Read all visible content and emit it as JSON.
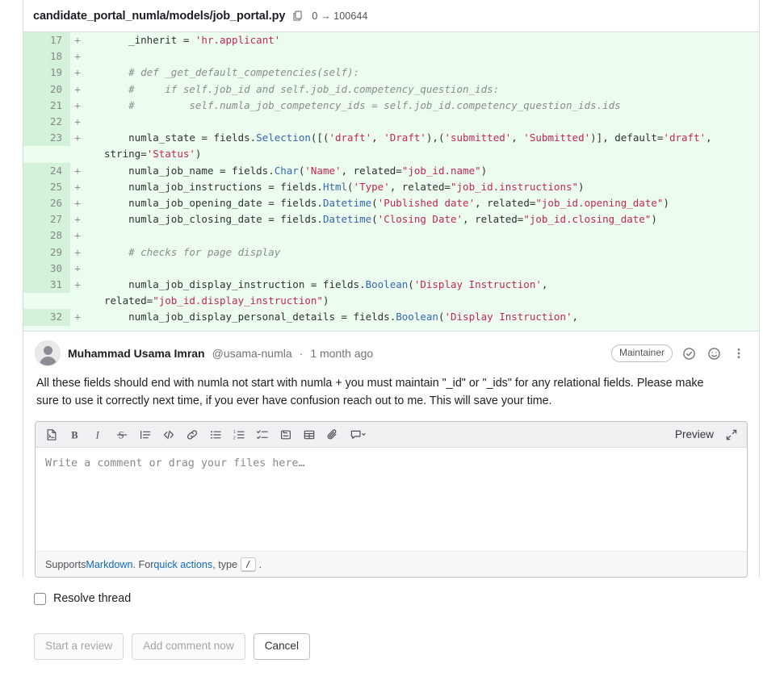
{
  "diff": {
    "file_path": "candidate_portal_numla/models/job_portal.py",
    "copy_icon": "copy-to-clipboard-icon",
    "mode_change": "0 → 100644",
    "lines": [
      {
        "number": "17",
        "marker": "+",
        "text": "    _inherit = 'hr.applicant'"
      },
      {
        "number": "18",
        "marker": "+",
        "text": ""
      },
      {
        "number": "19",
        "marker": "+",
        "text": "    # def _get_default_competencies(self):"
      },
      {
        "number": "20",
        "marker": "+",
        "text": "    #     if self.job_id and self.job_id.competency_question_ids:"
      },
      {
        "number": "21",
        "marker": "+",
        "text": "    #         self.numla_job_competency_ids = self.job_id.competency_question_ids.ids"
      },
      {
        "number": "22",
        "marker": "+",
        "text": ""
      },
      {
        "number": "23",
        "marker": "+",
        "text": "    numla_state = fields.Selection([('draft', 'Draft'),('submitted', 'Submitted')], default='draft', string='Status')"
      },
      {
        "number": "24",
        "marker": "+",
        "text": "    numla_job_name = fields.Char('Name', related=\"job_id.name\")"
      },
      {
        "number": "25",
        "marker": "+",
        "text": "    numla_job_instructions = fields.Html('Type', related=\"job_id.instructions\")"
      },
      {
        "number": "26",
        "marker": "+",
        "text": "    numla_job_opening_date = fields.Datetime('Published date', related=\"job_id.opening_date\")"
      },
      {
        "number": "27",
        "marker": "+",
        "text": "    numla_job_closing_date = fields.Datetime('Closing Date', related=\"job_id.closing_date\")"
      },
      {
        "number": "28",
        "marker": "+",
        "text": ""
      },
      {
        "number": "29",
        "marker": "+",
        "text": "    # checks for page display"
      },
      {
        "number": "30",
        "marker": "+",
        "text": ""
      },
      {
        "number": "31",
        "marker": "+",
        "text": "    numla_job_display_instruction = fields.Boolean('Display Instruction', related=\"job_id.display_instruction\")"
      },
      {
        "number": "32",
        "marker": "+",
        "text": "    numla_job_display_personal_details = fields.Boolean('Display Instruction',"
      }
    ]
  },
  "comment": {
    "author_name": "Muhammad Usama Imran",
    "author_handle": "@usama-numla",
    "separator": "·",
    "timestamp": "1 month ago",
    "role_badge": "Maintainer",
    "resolve_icon": "check-circle-icon",
    "emoji_icon": "smiley-face-icon",
    "more_icon": "vertical-ellipsis-icon",
    "avatar_icon": "user-avatar",
    "body": "All these fields should end with numla not start with numla + you must maintain \"_id\" or \"_ids\" for any relational fields. Please make sure to use it correctly next time, if you ever have confusion reach out to me. This will save your time."
  },
  "editor": {
    "toolbar_buttons": [
      {
        "name": "ai-assistant-icon",
        "title": "AI actions"
      },
      {
        "name": "bold-icon",
        "title": "Bold"
      },
      {
        "name": "italic-icon",
        "title": "Italic"
      },
      {
        "name": "strikethrough-icon",
        "title": "Strikethrough"
      },
      {
        "name": "quote-icon",
        "title": "Insert a quote"
      },
      {
        "name": "code-icon",
        "title": "Insert code"
      },
      {
        "name": "link-icon",
        "title": "Insert a link"
      },
      {
        "name": "bullet-list-icon",
        "title": "Add a bullet list"
      },
      {
        "name": "numbered-list-icon",
        "title": "Add a numbered list"
      },
      {
        "name": "checklist-icon",
        "title": "Add a checklist"
      },
      {
        "name": "collapsible-section-icon",
        "title": "Add a collapsible section"
      },
      {
        "name": "table-icon",
        "title": "Add a table"
      },
      {
        "name": "attachment-icon",
        "title": "Attach a file or image"
      },
      {
        "name": "comment-template-icon",
        "title": "Comment templates"
      }
    ],
    "preview_label": "Preview",
    "fullscreen_icon": "expand-arrows-icon",
    "placeholder": "Write a comment or drag your files here…",
    "value": "",
    "footer": {
      "prefix": "Supports ",
      "markdown_link": "Markdown",
      "middle": ". For ",
      "quick_actions_link": "quick actions",
      "type_text": ", type ",
      "slash_key": "/",
      "suffix": "."
    }
  },
  "resolve": {
    "checked": false,
    "label": "Resolve thread"
  },
  "actions": {
    "start_review": "Start a review",
    "add_comment": "Add comment now",
    "cancel": "Cancel"
  }
}
